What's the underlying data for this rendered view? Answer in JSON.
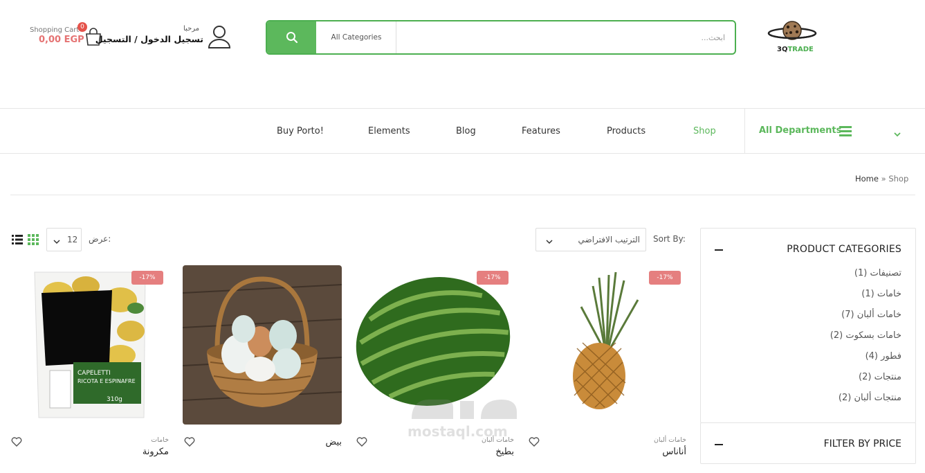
{
  "header": {
    "cart": {
      "label": "Shopping Cart",
      "total": "0,00 EGP",
      "count": "0"
    },
    "user": {
      "greeting": "مرحبا",
      "login_text": "تسجيل الدخول / التسجيل"
    },
    "search": {
      "category": "All Categories",
      "placeholder": "ابحث..."
    },
    "logo": {
      "part1": "3Q",
      "part2": "TRADE"
    }
  },
  "nav": {
    "items": [
      {
        "label": "Buy Porto!"
      },
      {
        "label": "Elements"
      },
      {
        "label": "Blog"
      },
      {
        "label": "Features"
      },
      {
        "label": "Products"
      },
      {
        "label": "Shop"
      }
    ],
    "active": "Shop",
    "departments_label": "All Departments"
  },
  "breadcrumb": {
    "home": "Home",
    "separator": "»",
    "current": "Shop"
  },
  "toolbar": {
    "show_label": "عرض:",
    "per_page": "12",
    "sort_label": "Sort By:",
    "sort_value": "الترتيب الافتراضي"
  },
  "sidebar": {
    "categories_title": "PRODUCT CATEGORIES",
    "categories": [
      {
        "label": "تصنيفات (1)"
      },
      {
        "label": "خامات (1)"
      },
      {
        "label": "خامات ألبان (7)"
      },
      {
        "label": "خامات بسكوت (2)"
      },
      {
        "label": "فطور (4)"
      },
      {
        "label": "منتجات (2)"
      },
      {
        "label": "منتجات ألبان (2)"
      }
    ],
    "filter_title": "FILTER BY PRICE"
  },
  "products": [
    {
      "badge": "-17%",
      "category": "خامات ألبان",
      "name": "أناناس",
      "image": "pineapple"
    },
    {
      "badge": "-17%",
      "category": "خامات ألبان",
      "name": "بطيخ",
      "image": "watermelon"
    },
    {
      "badge": "",
      "category": "",
      "name": "بيض",
      "image": "eggs-basket"
    },
    {
      "badge": "-17%",
      "category": "خامات",
      "name": "مكرونة",
      "image": "pasta-package"
    }
  ],
  "watermark": {
    "text": "mostaql.com"
  },
  "colors": {
    "accent": "#5cb85c",
    "badge": "#e57f7f",
    "price": "#e57373"
  }
}
